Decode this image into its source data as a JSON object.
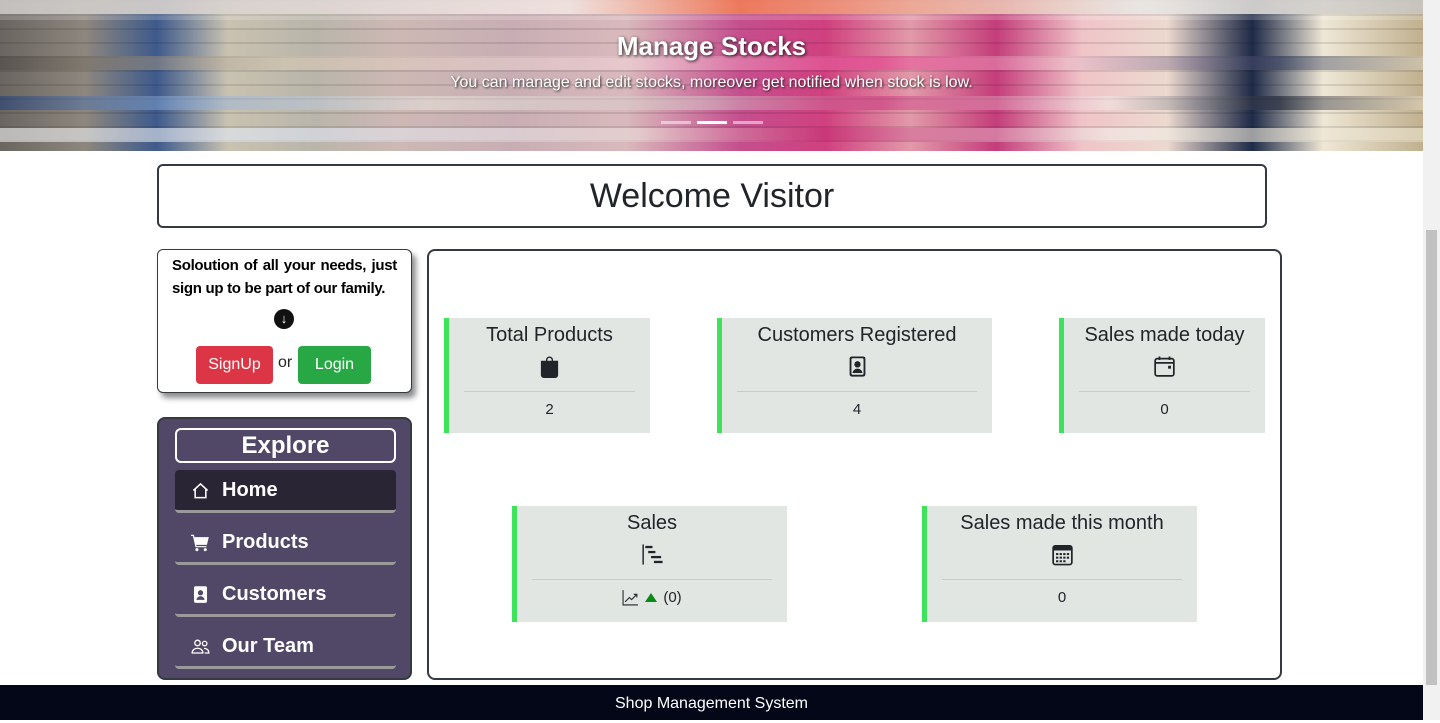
{
  "hero": {
    "title": "Manage Stocks",
    "caption": "You can manage and edit stocks, moreover get notified when stock is low.",
    "slide_count": 3,
    "active_slide": 2
  },
  "welcome": {
    "text": "Welcome Visitor"
  },
  "signup_card": {
    "text": "Soloution of all your needs, just sign up to be part of our family.",
    "signup_label": "SignUp",
    "or_label": "or",
    "login_label": "Login",
    "signup_color": "#dc3545",
    "login_color": "#28a745"
  },
  "explore": {
    "title": "Explore",
    "items": [
      {
        "label": "Home",
        "icon": "house-icon",
        "active": true
      },
      {
        "label": "Products",
        "icon": "cart-icon",
        "active": false
      },
      {
        "label": "Customers",
        "icon": "contact-card-icon",
        "active": false
      },
      {
        "label": "Our Team",
        "icon": "people-icon",
        "active": false
      }
    ]
  },
  "dashboard": {
    "cards": [
      {
        "title": "Total Products",
        "icon": "shopping-bag-icon",
        "value": "2"
      },
      {
        "title": "Customers Registered",
        "icon": "person-badge-icon",
        "value": "4"
      },
      {
        "title": "Sales made today",
        "icon": "calendar-icon",
        "value": "0"
      },
      {
        "title": "Sales",
        "icon": "bar-chart-steps-icon",
        "value": "(0)",
        "trend": "up"
      },
      {
        "title": "Sales made this month",
        "icon": "calendar-month-icon",
        "value": "0"
      }
    ],
    "accent_color": "#3de35a",
    "card_bg": "#e1e6e3"
  },
  "footer": {
    "text": "Shop Management System"
  }
}
